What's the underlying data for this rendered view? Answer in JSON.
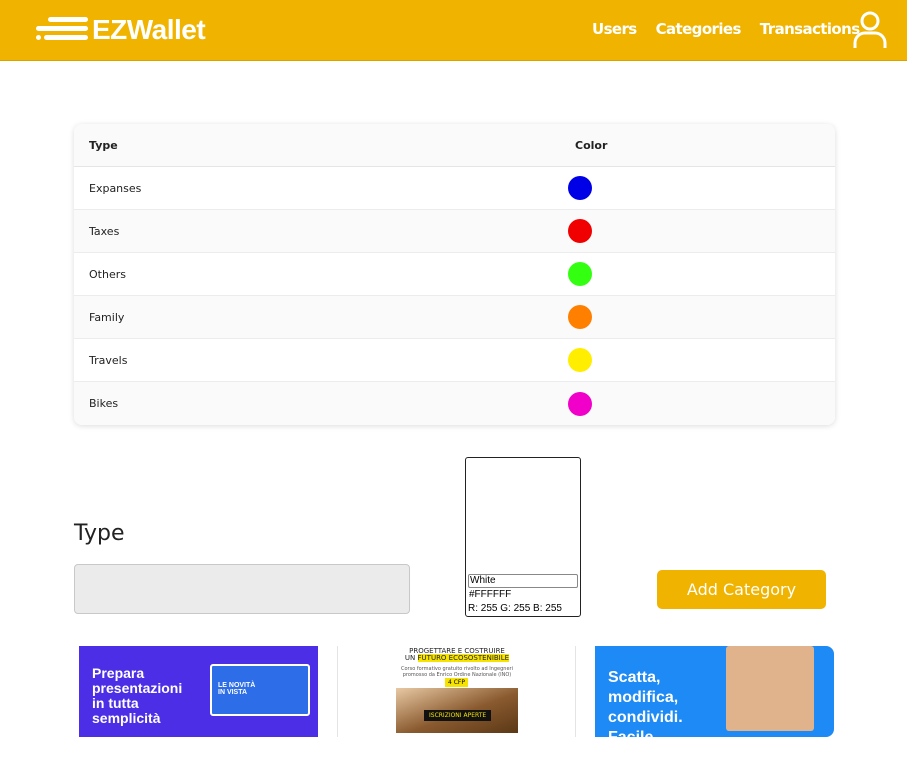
{
  "navbar": {
    "brand": "EZWallet",
    "links": [
      "Users",
      "Categories",
      "Transactions"
    ]
  },
  "table": {
    "headers": {
      "type": "Type",
      "color": "Color"
    },
    "rows": [
      {
        "type": "Expanses",
        "color": "#0000e6"
      },
      {
        "type": "Taxes",
        "color": "#f00000"
      },
      {
        "type": "Others",
        "color": "#33ff11"
      },
      {
        "type": "Family",
        "color": "#ff8000"
      },
      {
        "type": "Travels",
        "color": "#ffee00"
      },
      {
        "type": "Bikes",
        "color": "#f000c8"
      }
    ]
  },
  "form": {
    "type_label": "Type",
    "type_value": "",
    "color_picker": {
      "name": "White",
      "hex": "#FFFFFF",
      "rgb": "R: 255 G: 255 B: 255"
    },
    "submit_label": "Add Category"
  },
  "ads": {
    "ad1": {
      "headline": "Prepara\npresentazioni\nin tutta\nsemplicità",
      "tag": "LE NOVITÀ\nIN VISTA"
    },
    "ad2": {
      "line1": "PROGETTARE E COSTRUIRE",
      "line2_pre": "UN ",
      "line2_highlight": "FUTURO ECOSOSTENIBILE",
      "body": "Corso formativo gratuito rivolto ad Ingegneri\npromosso da Enrico Ordine Nazionale (INO)",
      "price": "4 CFP",
      "cta": "ISCRIZIONI APERTE"
    },
    "ad3": {
      "headline": "Scatta,\nmodifica,\ncondividi.\nFacile"
    }
  },
  "colors": {
    "accent": "#efb300"
  }
}
